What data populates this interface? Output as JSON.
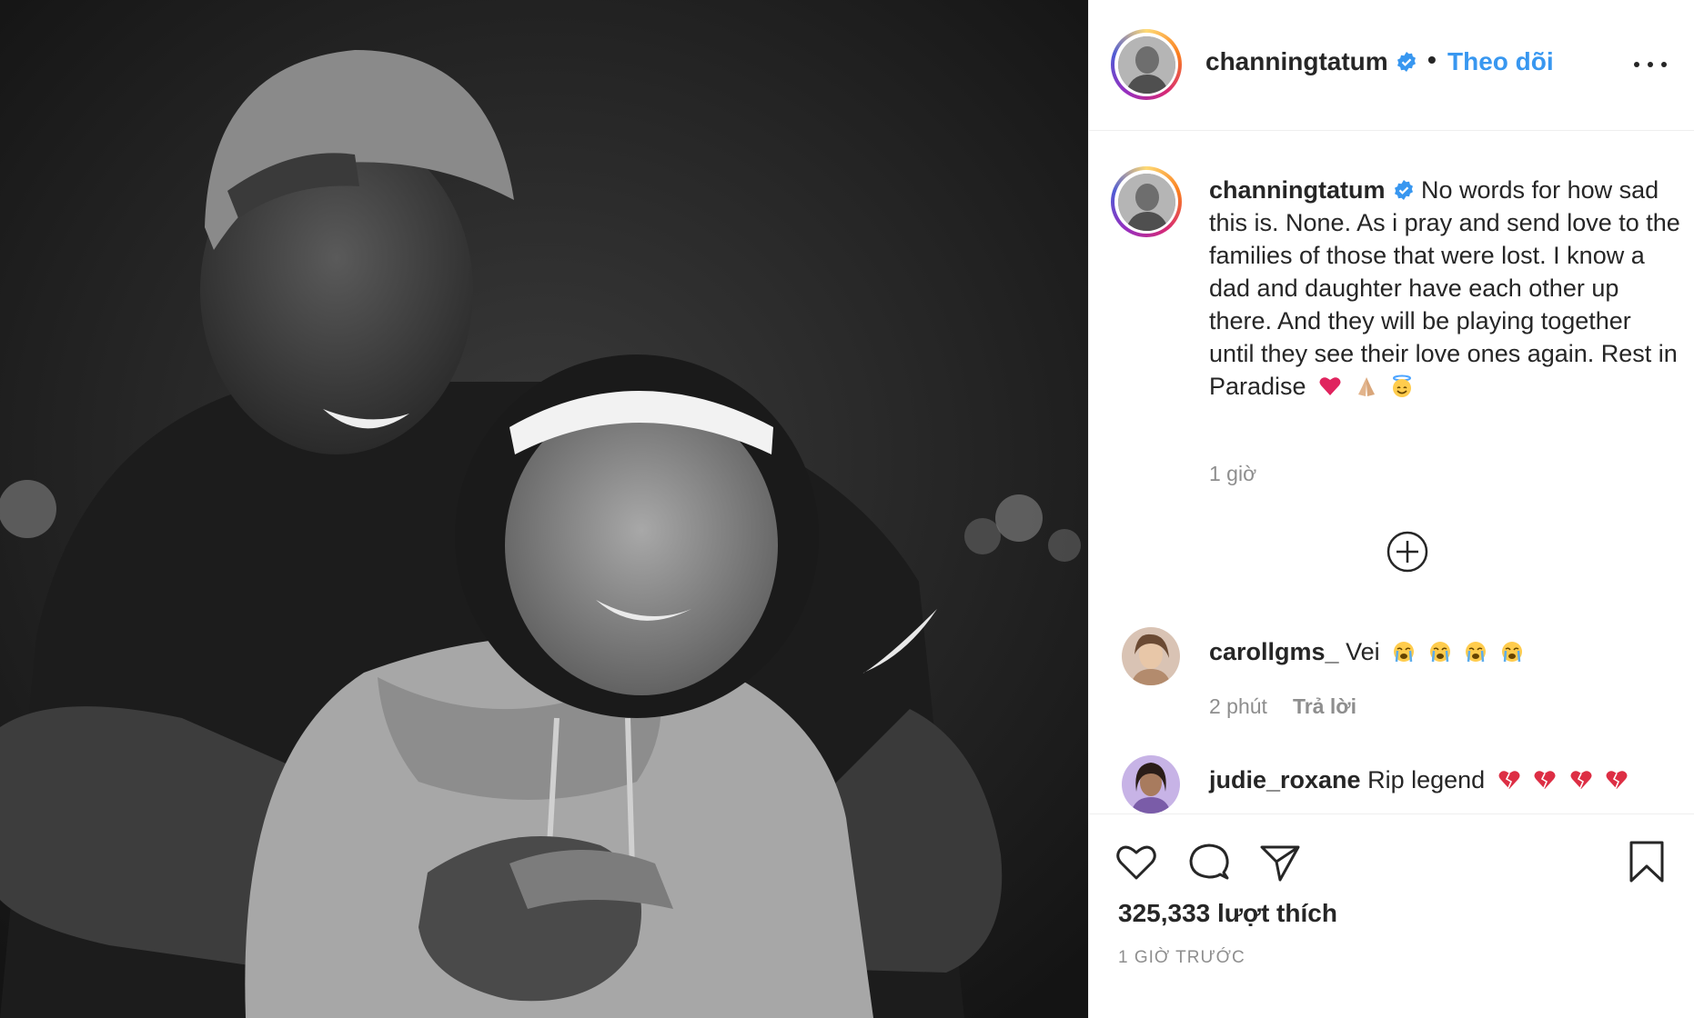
{
  "header": {
    "username": "channingtatum",
    "separator": "•",
    "follow_label": "Theo dõi"
  },
  "caption": {
    "username": "channingtatum",
    "text": "No words for how sad this is. None. As i pray and send love to the families of those that were lost. I know a dad and daughter have each other up there. And they will be playing together until they see their love ones again. Rest in Paradise",
    "emojis": [
      "red-heart",
      "folded-hands",
      "smiling-face-with-halo"
    ],
    "time": "1 giờ"
  },
  "comments": [
    {
      "username": "carollgms_",
      "text": "Vei",
      "emojis": [
        "crying-face",
        "crying-face",
        "crying-face",
        "crying-face"
      ],
      "time": "2 phút",
      "reply_label": "Trả lời"
    },
    {
      "username": "judie_roxane",
      "text": "Rip legend",
      "emojis": [
        "broken-heart",
        "broken-heart",
        "broken-heart",
        "broken-heart"
      ]
    }
  ],
  "footer": {
    "likes": "325,333 lượt thích",
    "posted": "1 GIỜ TRƯỚC"
  },
  "icons": {
    "like": "heart-icon",
    "comment": "comment-icon",
    "share": "paper-plane-icon",
    "save": "bookmark-icon",
    "more": "more-options-icon",
    "load_more": "plus-circle-icon",
    "verified": "verified-badge-icon"
  },
  "colors": {
    "link_blue": "#3897f0",
    "verified_blue": "#3897f0",
    "muted": "#8e8e8e",
    "text": "#262626"
  }
}
